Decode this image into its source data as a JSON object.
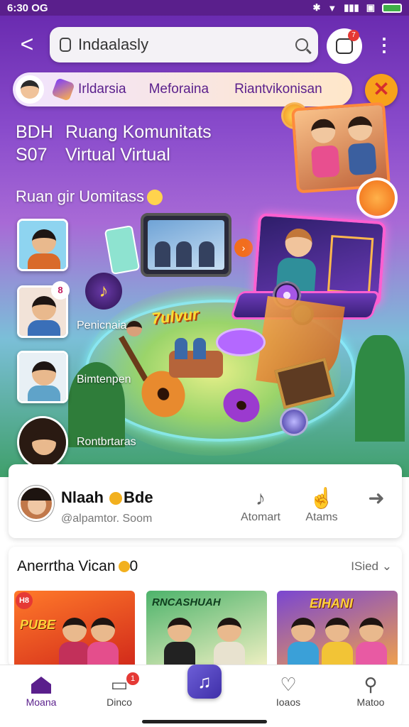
{
  "status_bar": {
    "time": "6:30 OG"
  },
  "top_bar": {
    "search_value": "Indaalasly",
    "notification_count": "7"
  },
  "tabs": [
    {
      "label": "Irldarsia"
    },
    {
      "label": "Meforaina"
    },
    {
      "label": "Riantvikonisan"
    }
  ],
  "hero": {
    "line1_code": "BDH",
    "line1_text": "Ruang Komunitats",
    "line2_code": "S07",
    "line2_text": "Virtual Virtual",
    "subheading": "Ruan gir Uomitass",
    "island_sign": "7ulvur",
    "side_items": [
      {
        "label": ""
      },
      {
        "label": "Penicnaia",
        "badge": "8"
      },
      {
        "label": "Bimtenpen"
      },
      {
        "label": "Rontbrtaras"
      }
    ]
  },
  "profile": {
    "name_part1": "Nlaah",
    "name_part2": "Bde",
    "subtitle": "@alpamtor. Soom",
    "actions": [
      {
        "label": "Atomart",
        "icon": "music-note-icon"
      },
      {
        "label": "Atams",
        "icon": "thumb-icon"
      },
      {
        "label": "",
        "icon": "share-arrow-icon"
      }
    ]
  },
  "videos": {
    "title": "Anerrtha Vican",
    "title_suffix": "0",
    "sort_label": "ISied",
    "thumbs": [
      {
        "text": "PUBE",
        "badge": "H8"
      },
      {
        "text": "RNCASHUAH",
        "badge": ""
      },
      {
        "text": "EIHANI",
        "badge": ""
      }
    ]
  },
  "bottom_nav": [
    {
      "label": "Moana",
      "icon": "home-icon",
      "active": true
    },
    {
      "label": "Dinco",
      "icon": "chat-icon",
      "badge": "1"
    },
    {
      "label": "",
      "icon": "music-app-icon"
    },
    {
      "label": "Ioaos",
      "icon": "heart-icon"
    },
    {
      "label": "Matoo",
      "icon": "person-icon"
    }
  ],
  "colors": {
    "brand_purple": "#5a1f8c",
    "accent_orange": "#f7a21b",
    "alert_red": "#e53935"
  }
}
